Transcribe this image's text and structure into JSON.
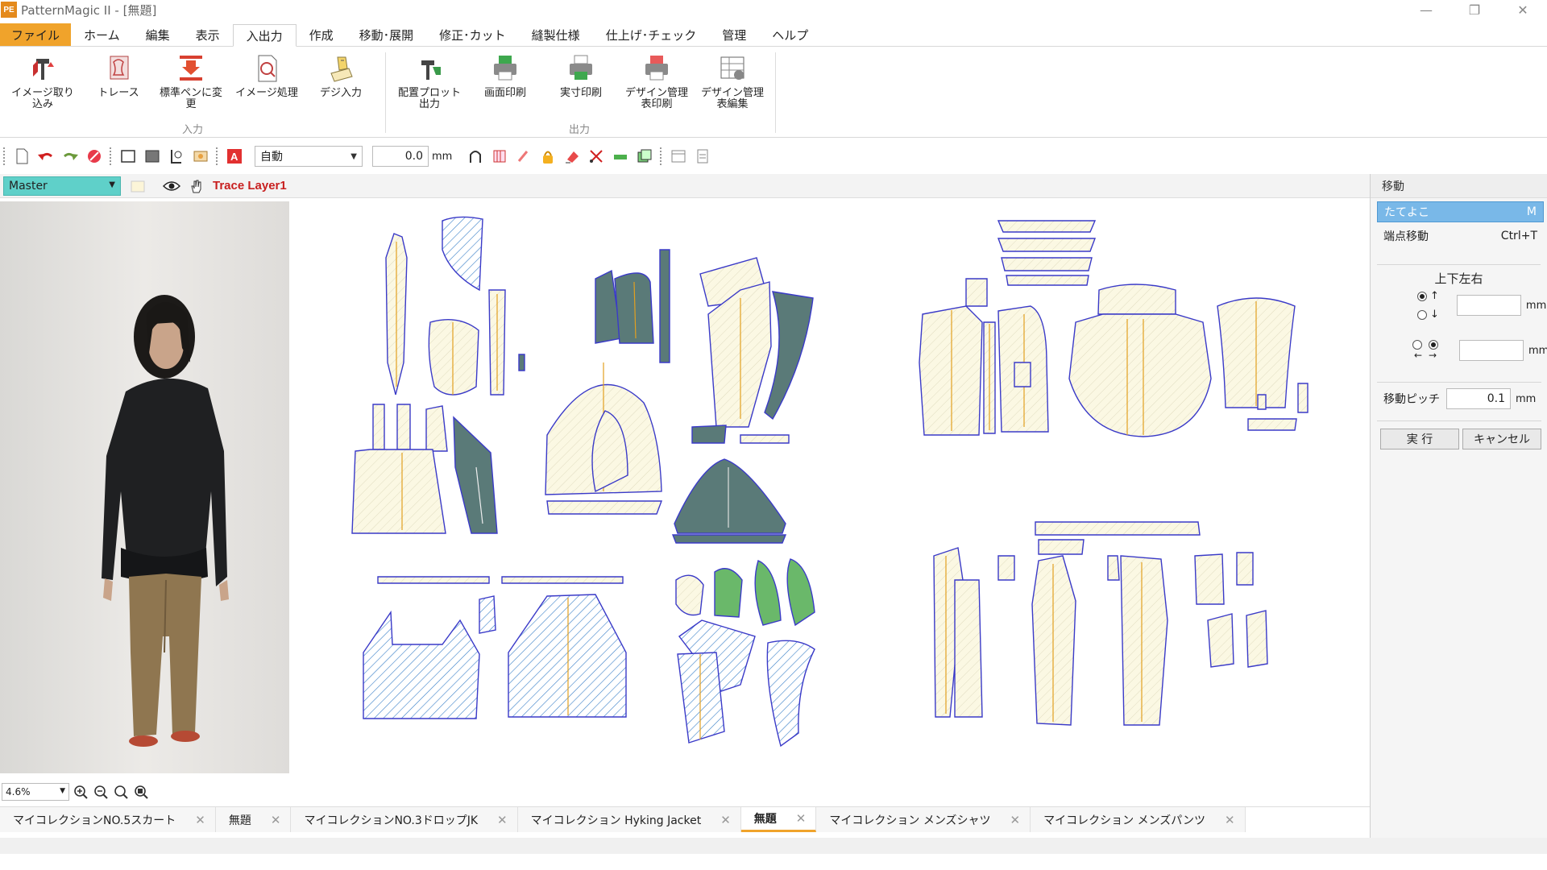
{
  "window": {
    "title": "PatternMagic II - [無題]",
    "logo_text": "PE"
  },
  "menu": {
    "tabs": [
      "ファイル",
      "ホーム",
      "編集",
      "表示",
      "入出力",
      "作成",
      "移動･展開",
      "修正･カット",
      "縫製仕様",
      "仕上げ･チェック",
      "管理",
      "ヘルプ"
    ],
    "active": "入出力"
  },
  "ribbon": {
    "input_group": {
      "label": "入力",
      "buttons": [
        "イメージ取り込み",
        "トレース",
        "標準ペンに変更",
        "イメージ処理",
        "デジ入力"
      ]
    },
    "output_group": {
      "label": "出力",
      "buttons": [
        "配置プロット出力",
        "画面印刷",
        "実寸印刷",
        "デザイン管理表印刷",
        "デザイン管理表編集"
      ]
    }
  },
  "toolbar": {
    "mode_select": "自動",
    "value": "0.0",
    "unit": "mm"
  },
  "layer": {
    "master": "Master",
    "trace_layer": "Trace Layer1"
  },
  "right_panel": {
    "title": "移動",
    "items": [
      {
        "label": "たてよこ",
        "shortcut": "M"
      },
      {
        "label": "端点移動",
        "shortcut": "Ctrl+T"
      }
    ],
    "section": "上下左右",
    "unit": "mm",
    "pitch_label": "移動ピッチ",
    "pitch_value": "0.1",
    "execute": "実 行",
    "cancel": "キャンセル"
  },
  "zoom": {
    "level": "4.6%"
  },
  "doc_tabs": [
    {
      "label": "マイコレクションNO.5スカート",
      "active": false
    },
    {
      "label": "無題",
      "active": false
    },
    {
      "label": "マイコレクションNO.3ドロップJK",
      "active": false
    },
    {
      "label": "マイコレクション Hyking Jacket",
      "active": false
    },
    {
      "label": "無題",
      "active": true
    },
    {
      "label": "マイコレクション メンズシャツ",
      "active": false
    },
    {
      "label": "マイコレクション メンズパンツ",
      "active": false
    }
  ],
  "colors": {
    "accent": "#f0a32b",
    "selection": "#79b8e8",
    "master": "#5fd0c9",
    "pattern_outline": "#3a3ac8",
    "pattern_fill": "#fbf8e3",
    "grain": "#e2a020"
  }
}
